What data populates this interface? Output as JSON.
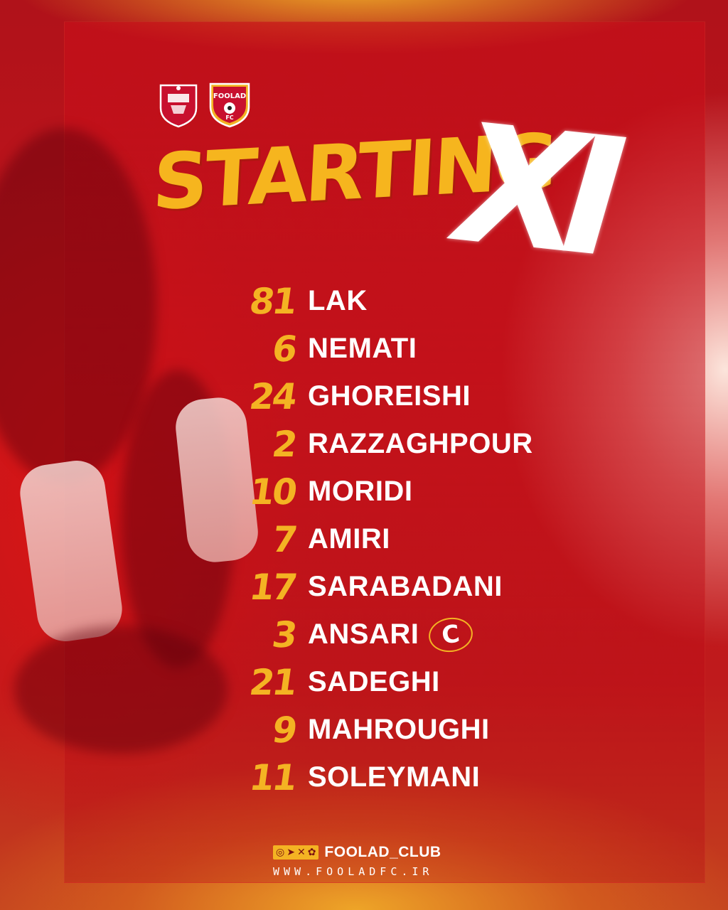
{
  "title": {
    "word": "STARTING",
    "suffix": "XI"
  },
  "crests": [
    {
      "icon": "persepolis-crest-icon",
      "color": "#c8102e"
    },
    {
      "icon": "foolad-fc-crest-icon",
      "text": "FOOLAD",
      "subtext": "FC",
      "color": "#f4b323"
    }
  ],
  "lineup": [
    {
      "number": "81",
      "name": "LAK"
    },
    {
      "number": "6",
      "name": "NEMATI"
    },
    {
      "number": "24",
      "name": "GHOREISHI"
    },
    {
      "number": "2",
      "name": "RAZZAGHPOUR"
    },
    {
      "number": "10",
      "name": "MORIDI"
    },
    {
      "number": "7",
      "name": "AMIRI"
    },
    {
      "number": "17",
      "name": "SARABADANI"
    },
    {
      "number": "3",
      "name": "ANSARI",
      "badge": "C"
    },
    {
      "number": "21",
      "name": "SADEGHI"
    },
    {
      "number": "9",
      "name": "MAHROUGHI"
    },
    {
      "number": "11",
      "name": "SOLEYMANI"
    }
  ],
  "footer": {
    "social_icons": [
      "instagram-icon",
      "telegram-icon",
      "x-icon",
      "aparat-icon"
    ],
    "handle": "FOOLAD_CLUB",
    "website": "WWW.FOOLADFC.IR"
  },
  "colors": {
    "accent": "#f4b323",
    "background": "#c3151c",
    "text": "#ffffff"
  }
}
